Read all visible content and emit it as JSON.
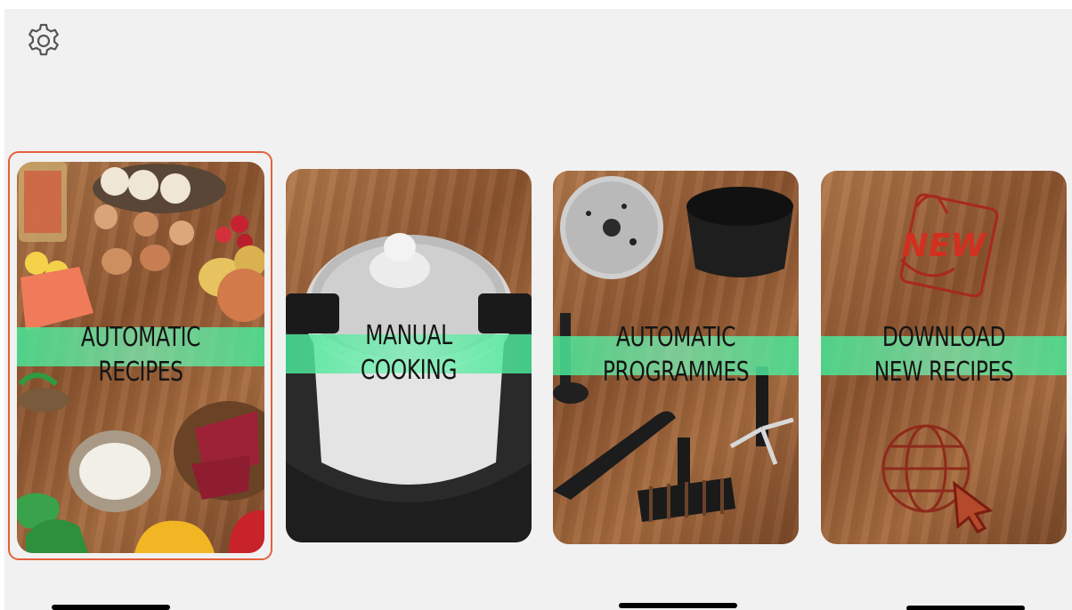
{
  "settings": {
    "icon": "gear-icon"
  },
  "cards": [
    {
      "id": "automatic-recipes",
      "line1": "AUTOMATIC",
      "line2": "RECIPES",
      "selected": true
    },
    {
      "id": "manual-cooking",
      "line1": "MANUAL",
      "line2": "COOKING",
      "selected": false
    },
    {
      "id": "automatic-programmes",
      "line1": "AUTOMATIC",
      "line2": "PROGRAMMES",
      "selected": false
    },
    {
      "id": "download-new-recipes",
      "line1": "DOWNLOAD",
      "line2": "NEW RECIPES",
      "selected": false
    }
  ],
  "artwork": {
    "new_stamp": "NEW"
  },
  "colors": {
    "selection": "#e4603e",
    "band": "#46e696"
  }
}
